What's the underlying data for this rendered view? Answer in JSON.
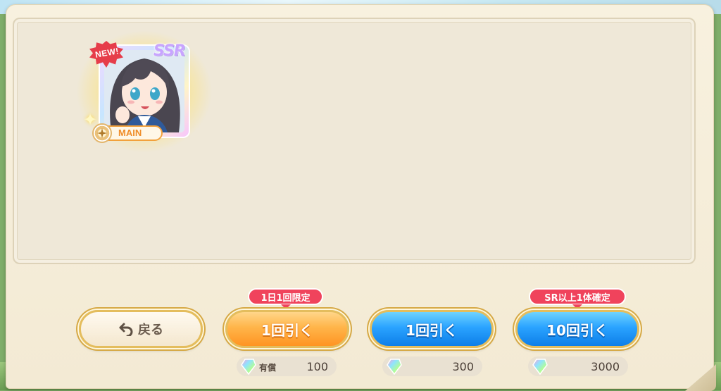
{
  "card": {
    "new_badge": "NEW!",
    "rarity": "SSR",
    "role_label": "MAIN",
    "icon": "character-portrait"
  },
  "buttons": {
    "back_label": "戻る",
    "pull_one_paid_label": "1回引く",
    "pull_one_label": "1回引く",
    "pull_ten_label": "10回引く"
  },
  "tags": {
    "daily_limit": "1日1回限定",
    "guarantee": "SR以上1体確定"
  },
  "costs": {
    "paid_label": "有償",
    "paid_one": "100",
    "one": "300",
    "ten": "3000"
  },
  "colors": {
    "orange_button": "#ffb54a",
    "blue_button": "#2aa3ff",
    "tag_red": "#f0435c",
    "gold_border": "#e4bd5d"
  }
}
